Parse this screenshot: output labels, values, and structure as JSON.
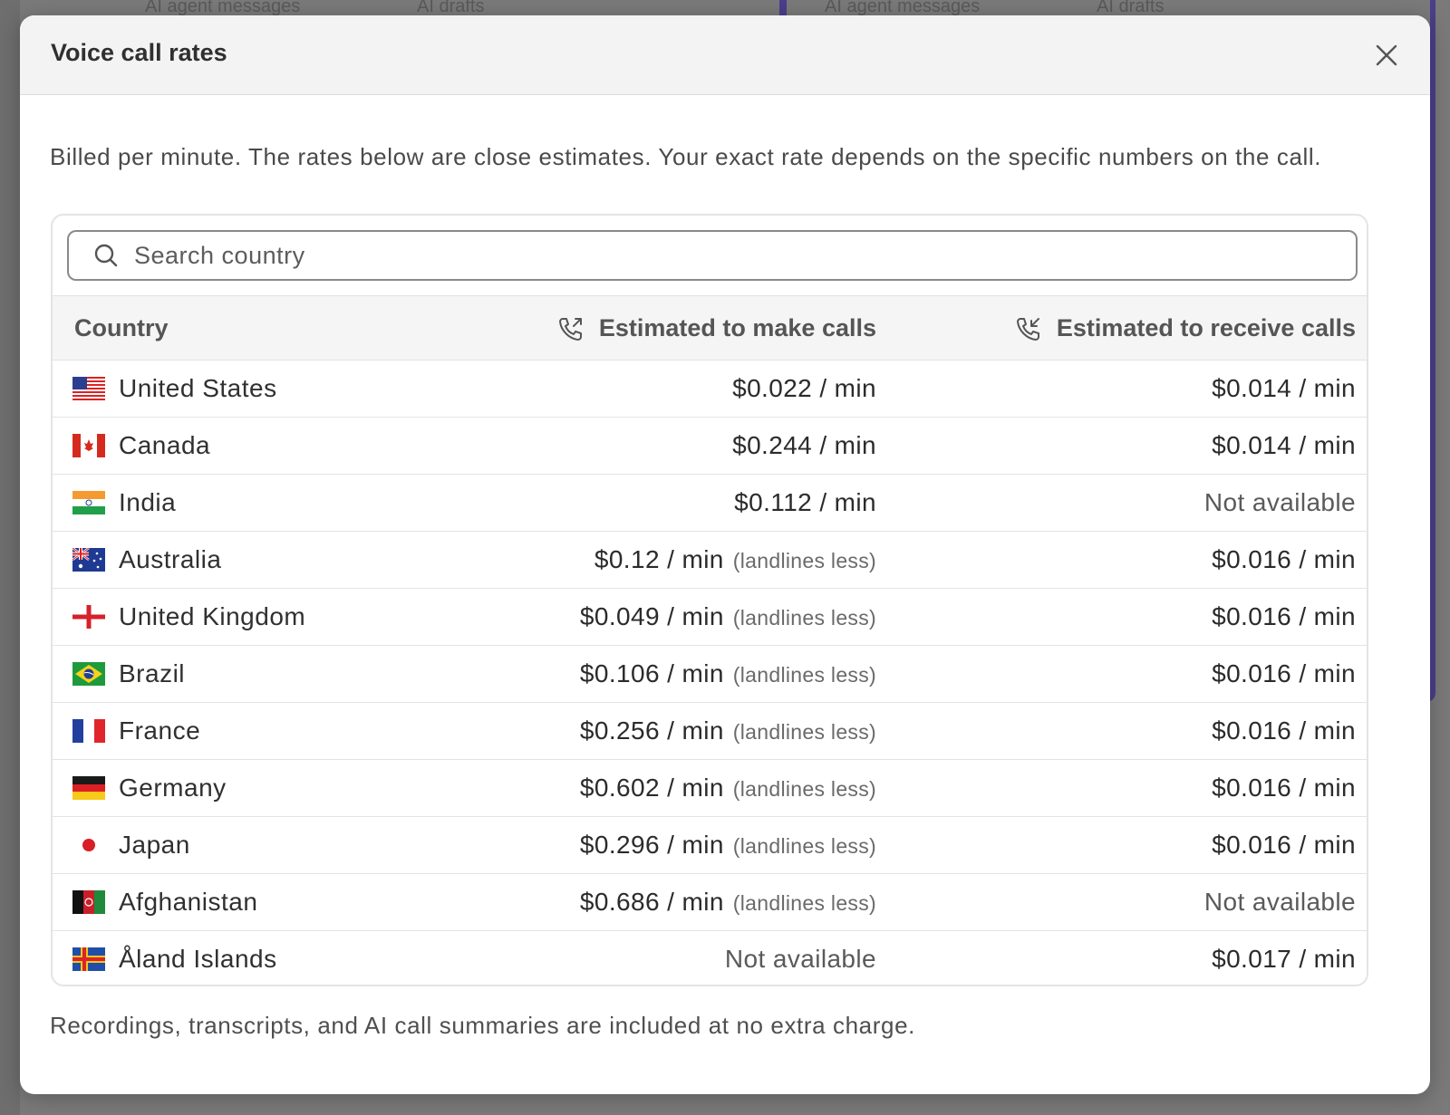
{
  "modal": {
    "title": "Voice call rates",
    "description": "Billed per minute. The rates below are close estimates. Your exact rate depends on the specific numbers on the call.",
    "footer": "Recordings, transcripts, and AI call summaries are included at no extra charge."
  },
  "search": {
    "placeholder": "Search country",
    "value": ""
  },
  "table": {
    "headers": {
      "country": "Country",
      "make": "Estimated to make calls",
      "receive": "Estimated to receive calls"
    },
    "rows": [
      {
        "country": "United States",
        "flag": "us-flag-icon",
        "make": "$0.022 / min",
        "make_note": "",
        "receive": "$0.014 / min"
      },
      {
        "country": "Canada",
        "flag": "ca-flag-icon",
        "make": "$0.244 / min",
        "make_note": "",
        "receive": "$0.014 / min"
      },
      {
        "country": "India",
        "flag": "in-flag-icon",
        "make": "$0.112 / min",
        "make_note": "",
        "receive": "Not available"
      },
      {
        "country": "Australia",
        "flag": "au-flag-icon",
        "make": "$0.12 / min",
        "make_note": "(landlines less)",
        "receive": "$0.016 / min"
      },
      {
        "country": "United Kingdom",
        "flag": "gb-flag-icon",
        "make": "$0.049 / min",
        "make_note": "(landlines less)",
        "receive": "$0.016 / min"
      },
      {
        "country": "Brazil",
        "flag": "br-flag-icon",
        "make": "$0.106 / min",
        "make_note": "(landlines less)",
        "receive": "$0.016 / min"
      },
      {
        "country": "France",
        "flag": "fr-flag-icon",
        "make": "$0.256 / min",
        "make_note": "(landlines less)",
        "receive": "$0.016 / min"
      },
      {
        "country": "Germany",
        "flag": "de-flag-icon",
        "make": "$0.602 / min",
        "make_note": "(landlines less)",
        "receive": "$0.016 / min"
      },
      {
        "country": "Japan",
        "flag": "jp-flag-icon",
        "make": "$0.296 / min",
        "make_note": "(landlines less)",
        "receive": "$0.016 / min"
      },
      {
        "country": "Afghanistan",
        "flag": "af-flag-icon",
        "make": "$0.686 / min",
        "make_note": "(landlines less)",
        "receive": "Not available"
      },
      {
        "country": "Åland Islands",
        "flag": "ax-flag-icon",
        "make": "Not available",
        "make_note": "",
        "receive": "$0.017 / min"
      }
    ]
  },
  "background": {
    "tabs": [
      "AI agent messages",
      "AI drafts",
      "AI agent messages",
      "AI drafts"
    ]
  },
  "colors": {
    "accent": "#4a3f8a",
    "overlay": "#7c7c7c",
    "header_bg": "#f3f3f3"
  }
}
